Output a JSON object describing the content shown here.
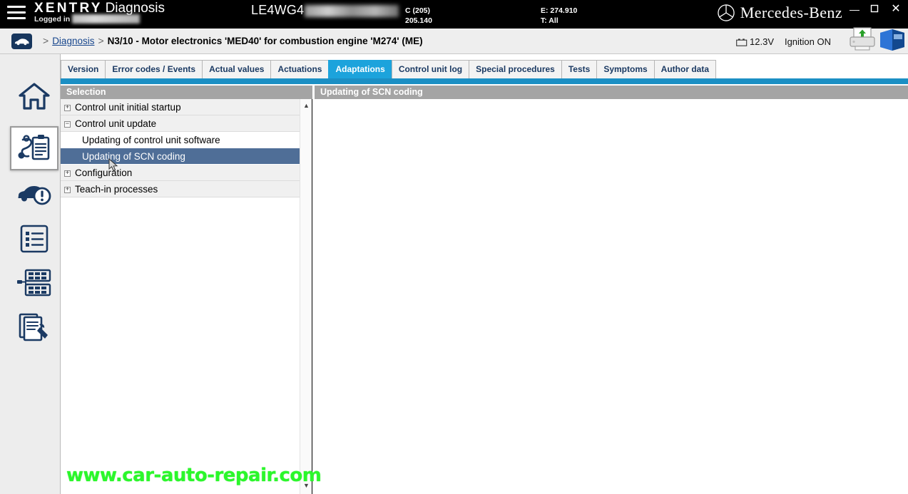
{
  "window": {
    "minimize_label": "—",
    "maximize_label": "❐",
    "close_label": "✕"
  },
  "topbar": {
    "menu_icon": "hamburger-icon",
    "brand_primary": "XENTRY",
    "brand_secondary": "Diagnosis",
    "logged_in_label": "Logged in",
    "logged_in_user": "",
    "vin_prefix": "LE4WG4",
    "vin_masked": "",
    "model_line1": "C (205)",
    "model_line2": "205.140",
    "engine_line1": "E: 274.910",
    "engine_line2": "T: All",
    "oem_brand": "Mercedes-Benz",
    "oem_icon": "mercedes-star-icon"
  },
  "breadcrumb": {
    "vehicle_icon": "car-icon",
    "separator": ">",
    "link": "Diagnosis",
    "current": "N3/10 - Motor electronics 'MED40' for combustion engine 'M274' (ME)"
  },
  "status": {
    "battery_icon": "battery-icon",
    "voltage": "12.3V",
    "ignition": "Ignition ON",
    "print_icon": "printer-upload-icon",
    "help_icon": "blue-book-icon"
  },
  "sidebar": {
    "items": [
      {
        "icon": "home-icon",
        "name": "home"
      },
      {
        "icon": "diagnosis-icon",
        "name": "diagnosis",
        "active": true
      },
      {
        "icon": "vehicle-alert-icon",
        "name": "quick-test"
      },
      {
        "icon": "list-icon",
        "name": "list"
      },
      {
        "icon": "network-icon",
        "name": "network-topology"
      },
      {
        "icon": "documents-tool-icon",
        "name": "documents"
      }
    ]
  },
  "tabs": [
    {
      "label": "Version",
      "active": false
    },
    {
      "label": "Error codes / Events",
      "active": false
    },
    {
      "label": "Actual values",
      "active": false
    },
    {
      "label": "Actuations",
      "active": false
    },
    {
      "label": "Adaptations",
      "active": true
    },
    {
      "label": "Control unit log",
      "active": false
    },
    {
      "label": "Special procedures",
      "active": false
    },
    {
      "label": "Tests",
      "active": false
    },
    {
      "label": "Symptoms",
      "active": false
    },
    {
      "label": "Author data",
      "active": false
    }
  ],
  "selection_panel": {
    "header": "Selection",
    "scroll_up": "▲",
    "scroll_down": "▼",
    "rows": [
      {
        "label": "Control unit initial startup",
        "type": "group",
        "expander": "+",
        "selected": false
      },
      {
        "label": "Control unit update",
        "type": "group",
        "expander": "−",
        "selected": false
      },
      {
        "label": "Updating of control unit software",
        "type": "leaf",
        "expander": "",
        "selected": false
      },
      {
        "label": "Updating of SCN coding",
        "type": "leaf",
        "expander": "",
        "selected": true
      },
      {
        "label": "Configuration",
        "type": "group",
        "expander": "+",
        "selected": false
      },
      {
        "label": "Teach-in processes",
        "type": "group",
        "expander": "+",
        "selected": false
      }
    ]
  },
  "content_panel": {
    "header": "Updating of SCN coding",
    "body": ""
  },
  "watermark": {
    "text": "www.car-auto-repair.com"
  },
  "colors": {
    "accent_tab": "#1ca3dc",
    "accent_underline": "#1b8fc4",
    "panel_header": "#a4a4a4",
    "selection_row": "#4f6e97",
    "brand_navy": "#17365d",
    "watermark_green": "#2bf72b"
  }
}
